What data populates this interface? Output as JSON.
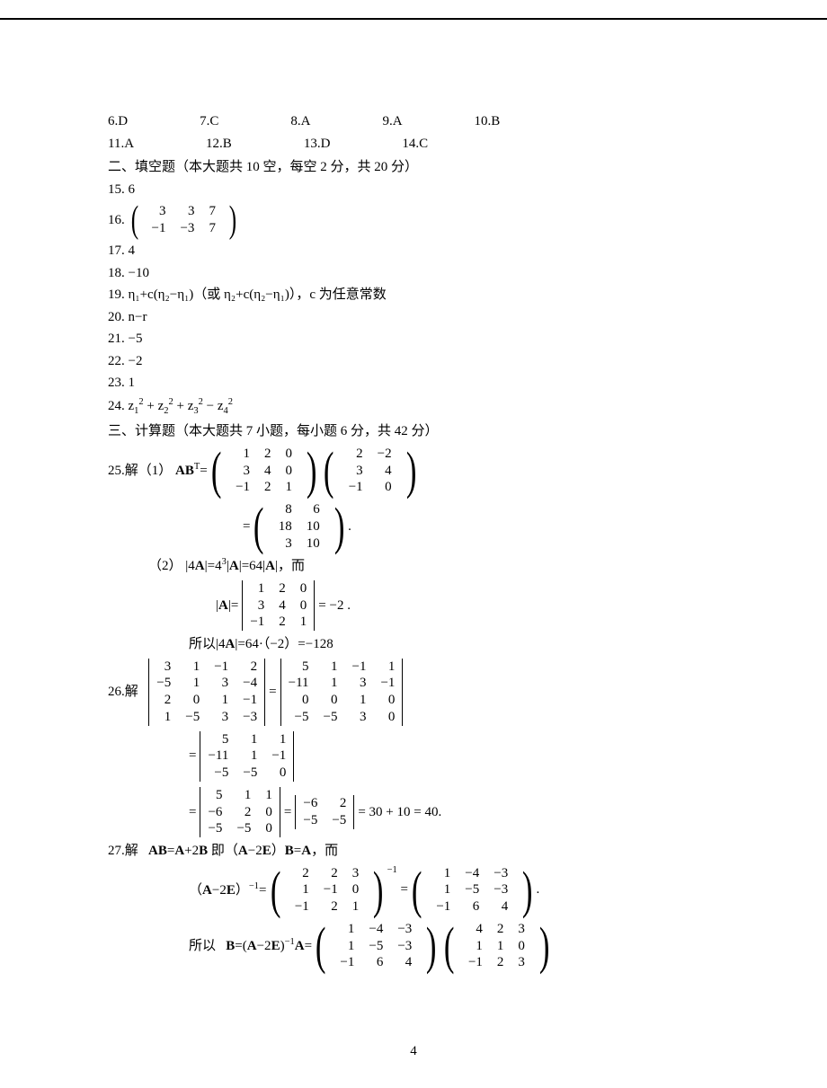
{
  "mc_answers": {
    "r1": [
      {
        "n": "6",
        "a": "D"
      },
      {
        "n": "7",
        "a": "C"
      },
      {
        "n": "8",
        "a": "A"
      },
      {
        "n": "9",
        "a": "A"
      },
      {
        "n": "10",
        "a": "B"
      }
    ],
    "r2": [
      {
        "n": "11",
        "a": "A"
      },
      {
        "n": "12",
        "a": "B"
      },
      {
        "n": "13",
        "a": "D"
      },
      {
        "n": "14",
        "a": "C"
      }
    ]
  },
  "section2_head": "二、填空题（本大题共 10 空，每空 2 分，共 20 分）",
  "fill": {
    "q15": "15. 6",
    "q16_label": "16.",
    "q16_matrix": [
      [
        "3",
        "3",
        "7"
      ],
      [
        "−1",
        "−3",
        "7"
      ]
    ],
    "q17": "17. 4",
    "q18": "18. −10",
    "q19": "19.  η₁+c(η₂−η₁)（或 η₂+c(η₂−η₁)），c 为任意常数",
    "q20": "20. n−r",
    "q21": "21. −5",
    "q22": "22. −2",
    "q23": "23. 1",
    "q24_pre": "24.  ",
    "q24_expr": "z₁² + z₂² + z₃² − z₄²"
  },
  "section3_head": "三、计算题（本大题共 7 小题，每小题 6 分，共 42 分）",
  "q25": {
    "label": "25.解（1）",
    "ABT": "ABᵀ=",
    "m1": [
      [
        "1",
        "2",
        "0"
      ],
      [
        "3",
        "4",
        "0"
      ],
      [
        "−1",
        "2",
        "1"
      ]
    ],
    "m2": [
      [
        "2",
        "−2"
      ],
      [
        "3",
        "4"
      ],
      [
        "−1",
        "0"
      ]
    ],
    "eq": "=",
    "m3": [
      [
        "8",
        "6"
      ],
      [
        "18",
        "10"
      ],
      [
        "3",
        "10"
      ]
    ],
    "dot": ".",
    "part2_label": "（2）",
    "part2_text1": "|4A|=4³|A|=64|A|，而",
    "detA_label": "|A|=",
    "detA": [
      [
        "1",
        "2",
        "0"
      ],
      [
        "3",
        "4",
        "0"
      ],
      [
        "−1",
        "2",
        "1"
      ]
    ],
    "detA_val": "= −2 .",
    "part2_text2": "所以|4A|=64·（−2）=−128"
  },
  "q26": {
    "label": "26.解",
    "d1": [
      [
        "3",
        "1",
        "−1",
        "2"
      ],
      [
        "−5",
        "1",
        "3",
        "−4"
      ],
      [
        "2",
        "0",
        "1",
        "−1"
      ],
      [
        "1",
        "−5",
        "3",
        "−3"
      ]
    ],
    "eq1": "=",
    "d2": [
      [
        "5",
        "1",
        "−1",
        "1"
      ],
      [
        "−11",
        "1",
        "3",
        "−1"
      ],
      [
        "0",
        "0",
        "1",
        "0"
      ],
      [
        "−5",
        "−5",
        "3",
        "0"
      ]
    ],
    "eq2": "=",
    "d3": [
      [
        "5",
        "1",
        "1"
      ],
      [
        "−11",
        "1",
        "−1"
      ],
      [
        "−5",
        "−5",
        "0"
      ]
    ],
    "eq3": "=",
    "d4": [
      [
        "5",
        "1",
        "1"
      ],
      [
        "−6",
        "2",
        "0"
      ],
      [
        "−5",
        "−5",
        "0"
      ]
    ],
    "eq4": "=",
    "d5": [
      [
        "−6",
        "2"
      ],
      [
        "−5",
        "−5"
      ]
    ],
    "result": "= 30 + 10 = 40."
  },
  "q27": {
    "label": "27.解",
    "line1": "AB=A+2B 即（A−2E）B=A，而",
    "inv_label": "（A−2E）⁻¹=",
    "m1": [
      [
        "2",
        "2",
        "3"
      ],
      [
        "1",
        "−1",
        "0"
      ],
      [
        "−1",
        "2",
        "1"
      ]
    ],
    "inv_sup": "−1",
    "eq1": "=",
    "m2": [
      [
        "1",
        "−4",
        "−3"
      ],
      [
        "1",
        "−5",
        "−3"
      ],
      [
        "−1",
        "6",
        "4"
      ]
    ],
    "dot": ".",
    "line3_pre": "所以   B=(A−2E)⁻¹A=",
    "m3": [
      [
        "1",
        "−4",
        "−3"
      ],
      [
        "1",
        "−5",
        "−3"
      ],
      [
        "−1",
        "6",
        "4"
      ]
    ],
    "m4": [
      [
        "4",
        "2",
        "3"
      ],
      [
        "1",
        "1",
        "0"
      ],
      [
        "−1",
        "2",
        "3"
      ]
    ]
  },
  "page_number": "4"
}
